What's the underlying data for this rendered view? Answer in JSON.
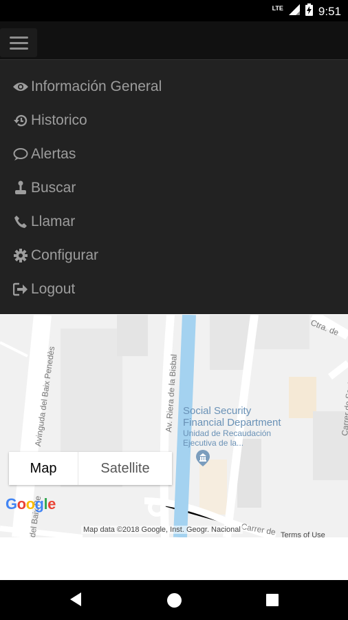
{
  "status_bar": {
    "network": "LTE",
    "time": "9:51",
    "icons": [
      "signal-icon",
      "battery-charging-icon"
    ]
  },
  "app_bar": {
    "menu_icon": "hamburger-menu-icon"
  },
  "drawer": {
    "items": [
      {
        "label": "Información General",
        "icon": "eye-icon"
      },
      {
        "label": "Historico",
        "icon": "history-icon"
      },
      {
        "label": "Alertas",
        "icon": "comment-icon"
      },
      {
        "label": "Buscar",
        "icon": "joystick-icon"
      },
      {
        "label": "Llamar",
        "icon": "phone-icon"
      },
      {
        "label": "Configurar",
        "icon": "gear-icon"
      },
      {
        "label": "Logout",
        "icon": "logout-icon"
      }
    ]
  },
  "map": {
    "toggle": {
      "map_label": "Map",
      "satellite_label": "Satellite",
      "selected": "Map"
    },
    "logo": {
      "g1": "G",
      "o1": "o",
      "o2": "o",
      "g2": "g",
      "l": "l",
      "e": "e"
    },
    "attribution": "Map data ©2018 Google, Inst. Geogr. Nacional",
    "terms": "Terms of Use",
    "poi": {
      "title_line1": "Social Security",
      "title_line2": "Financial Department",
      "subtitle_line1": "Unidad de Recaudación",
      "subtitle_line2": "Ejecutiva de la..."
    },
    "streets": {
      "avinguda": "Avinguda del Baix Penedès",
      "riera": "Av. Riera de la Bisbal",
      "carrer_santa": "Carrer de Santa Ana",
      "ctra": "Ctra. de",
      "bottom_left": "del Baix Pe",
      "bottom_center": "Carrer de"
    },
    "colors": {
      "water": "#a4d2f0",
      "road": "#ffffff",
      "land": "#f1f1f1",
      "poi_text": "#6991b6"
    }
  },
  "system_nav": {
    "back": "back-icon",
    "home": "home-icon",
    "recents": "recents-icon"
  }
}
